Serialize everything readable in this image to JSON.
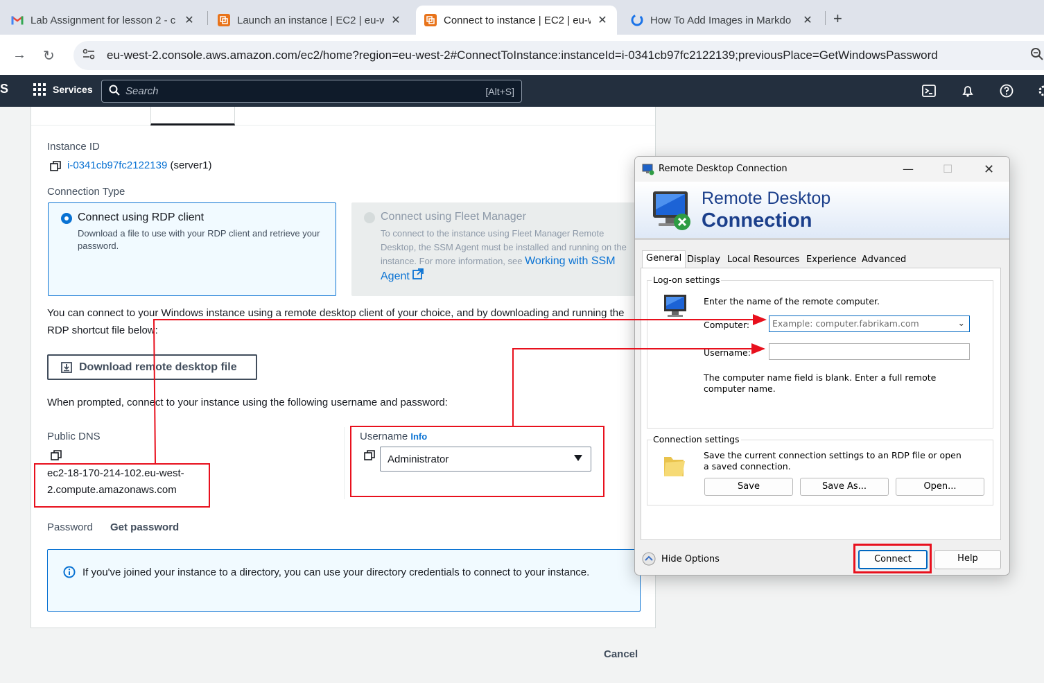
{
  "browser": {
    "tabs": [
      {
        "title": "Lab Assignment for lesson 2 - c",
        "icon": "gmail-icon"
      },
      {
        "title": "Launch an instance | EC2 | eu-w",
        "icon": "aws-ec2-icon"
      },
      {
        "title": "Connect to instance | EC2 | eu-w",
        "icon": "aws-ec2-icon",
        "active": true
      },
      {
        "title": "How To Add Images in Markdo",
        "icon": "site-icon"
      }
    ],
    "url": "eu-west-2.console.aws.amazon.com/ec2/home?region=eu-west-2#ConnectToInstance:instanceId=i-0341cb97fc2122139;previousPlace=GetWindowsPassword"
  },
  "aws_header": {
    "logo": "S",
    "services": "Services",
    "search_placeholder": "Search",
    "search_shortcut": "[Alt+S]"
  },
  "connect": {
    "instance_id_label": "Instance ID",
    "instance_id": "i-0341cb97fc2122139",
    "instance_name": "(server1)",
    "connection_type_label": "Connection Type",
    "rdp_option_title": "Connect using RDP client",
    "rdp_option_desc": "Download a file to use with your RDP client and retrieve your password.",
    "fleet_option_title": "Connect using Fleet Manager",
    "fleet_option_desc": "To connect to the instance using Fleet Manager Remote Desktop, the SSM Agent must be installed and running on the instance. For more information, see",
    "fleet_option_link": "Working with SSM Agent",
    "intro_text": "You can connect to your Windows instance using a remote desktop client of your choice, and by downloading and running the RDP shortcut file below:",
    "download_button": "Download remote desktop file",
    "prompt_text": "When prompted, connect to your instance using the following username and password:",
    "public_dns_label": "Public DNS",
    "public_dns_line1": "ec2-18-170-214-102.eu-west-",
    "public_dns_line2": "2.compute.amazonaws.com",
    "username_label": "Username",
    "username_info": "Info",
    "username_value": "Administrator",
    "password_label": "Password",
    "get_password": "Get password",
    "info_text": "If you've joined your instance to a directory, you can use your directory credentials to connect to your instance.",
    "cancel": "Cancel"
  },
  "rdp": {
    "window_title": "Remote Desktop Connection",
    "banner_line1": "Remote Desktop",
    "banner_line2": "Connection",
    "tabs": [
      "General",
      "Display",
      "Local Resources",
      "Experience",
      "Advanced"
    ],
    "logon_group": "Log-on settings",
    "logon_hint": "Enter the name of the remote computer.",
    "computer_label": "Computer:",
    "computer_placeholder": "Example: computer.fabrikam.com",
    "username_label": "Username:",
    "username_value": "",
    "blank_warning": "The computer name field is blank. Enter a full remote computer name.",
    "conn_group": "Connection settings",
    "conn_hint": "Save the current connection settings to an RDP file or open a saved connection.",
    "save": "Save",
    "save_as": "Save As...",
    "open": "Open...",
    "hide_options": "Hide Options",
    "connect": "Connect",
    "help": "Help"
  },
  "colors": {
    "aws_nav": "#232f3e",
    "aws_link": "#0972d3",
    "annotation_red": "#e8101d",
    "rdp_title_blue": "#1b3f8b"
  }
}
